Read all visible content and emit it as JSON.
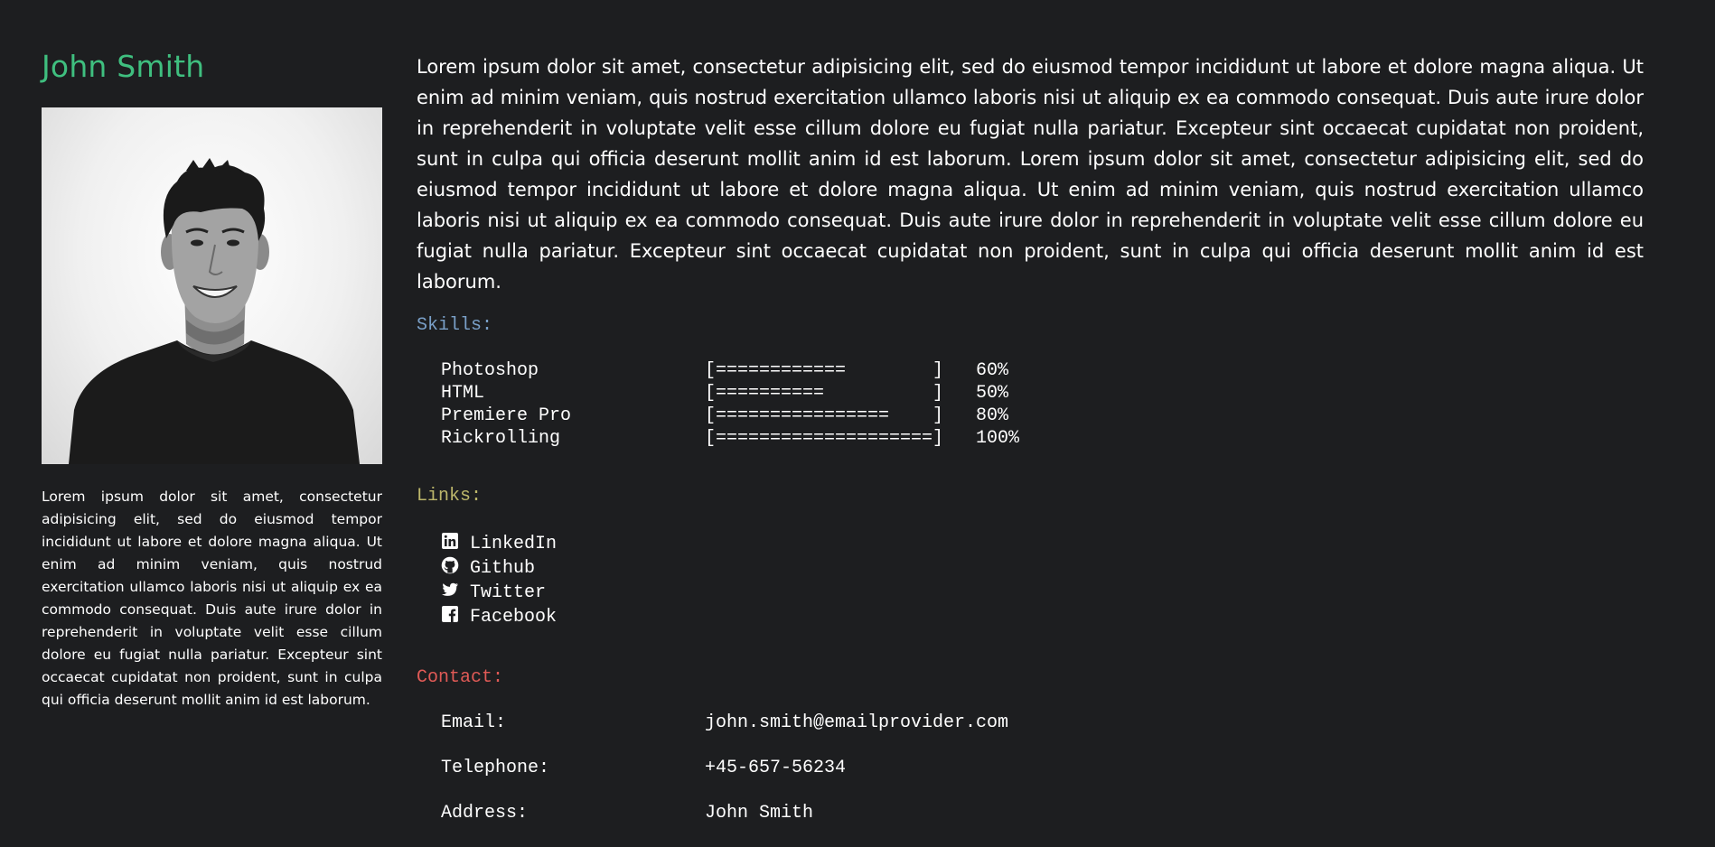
{
  "profile": {
    "name": "John Smith",
    "photo_alt": "Portrait of John Smith",
    "bio": "Lorem ipsum dolor sit amet, consectetur adipisicing elit, sed do eiusmod tempor incididunt ut labore et dolore magna aliqua. Ut enim ad minim veniam, quis nostrud exercitation ullamco laboris nisi ut aliquip ex ea commodo consequat. Duis aute irure dolor in reprehenderit in voluptate velit esse cillum dolore eu fugiat nulla pariatur. Excepteur sint occaecat cupidatat non proident, sunt in culpa qui officia deserunt mollit anim id est laborum."
  },
  "intro": "Lorem ipsum dolor sit amet, consectetur adipisicing elit, sed do eiusmod tempor incididunt ut labore et dolore magna aliqua. Ut enim ad minim veniam, quis nostrud exercitation ullamco laboris nisi ut aliquip ex ea commodo consequat. Duis aute irure dolor in reprehenderit in voluptate velit esse cillum dolore eu fugiat nulla pariatur. Excepteur sint occaecat cupidatat non proident, sunt in culpa qui officia deserunt mollit anim id est laborum. Lorem ipsum dolor sit amet, consectetur adipisicing elit, sed do eiusmod tempor incididunt ut labore et dolore magna aliqua. Ut enim ad minim veniam, quis nostrud exercitation ullamco laboris nisi ut aliquip ex ea commodo consequat. Duis aute irure dolor in reprehenderit in voluptate velit esse cillum dolore eu fugiat nulla pariatur. Excepteur sint occaecat cupidatat non proident, sunt in culpa qui officia deserunt mollit anim id est laborum.",
  "skills": {
    "title": "Skills:",
    "items": [
      {
        "name": "Photoshop",
        "bar": "[============        ]",
        "percent": "60%"
      },
      {
        "name": "HTML",
        "bar": "[==========          ]",
        "percent": "50%"
      },
      {
        "name": "Premiere Pro",
        "bar": "[================    ]",
        "percent": "80%"
      },
      {
        "name": "Rickrolling",
        "bar": "[====================]",
        "percent": "100%"
      }
    ]
  },
  "links": {
    "title": "Links:",
    "items": [
      {
        "label": "LinkedIn",
        "icon": "linkedin-icon"
      },
      {
        "label": "Github",
        "icon": "github-icon"
      },
      {
        "label": "Twitter",
        "icon": "twitter-icon"
      },
      {
        "label": "Facebook",
        "icon": "facebook-icon"
      }
    ]
  },
  "contact": {
    "title": "Contact:",
    "email_label": "Email:",
    "email_value": "john.smith@emailprovider.com",
    "phone_label": "Telephone:",
    "phone_value": "+45-657-56234",
    "address_label": "Address:",
    "address_value": "John Smith"
  },
  "colors": {
    "background": "#1d1e20",
    "name": "#3fbf7f",
    "skills_title": "#7aa0c8",
    "links_title": "#bdb76b",
    "contact_title": "#e05a56"
  }
}
